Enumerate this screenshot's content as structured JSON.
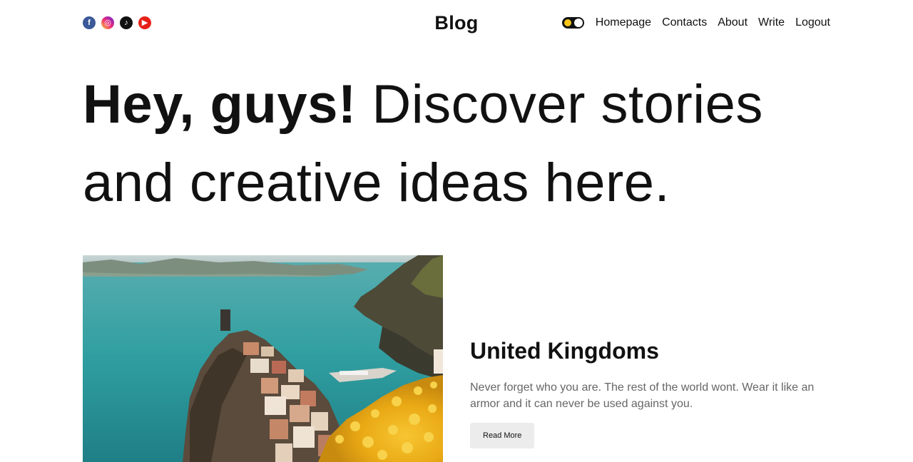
{
  "header": {
    "logo": "Blog",
    "social": [
      {
        "name": "facebook-icon",
        "glyph": "f"
      },
      {
        "name": "instagram-icon",
        "glyph": "◎"
      },
      {
        "name": "tiktok-icon",
        "glyph": "♪"
      },
      {
        "name": "youtube-icon",
        "glyph": "▶"
      }
    ],
    "nav": [
      "Homepage",
      "Contacts",
      "About",
      "Write",
      "Logout"
    ]
  },
  "hero": {
    "bold": "Hey, guys!",
    "rest_line1": "Discover stories",
    "line2": "and creative ideas here."
  },
  "featured": {
    "title": "United Kingdoms",
    "description": "Never forget who you are. The rest of the world wont. Wear it like an armor and it can never be used against you.",
    "button": "Read More"
  },
  "colors": {
    "text": "#111111",
    "muted": "#666666",
    "button_bg": "#ececec",
    "sea": "#2f9ea0",
    "flowers": "#f2b51c"
  }
}
